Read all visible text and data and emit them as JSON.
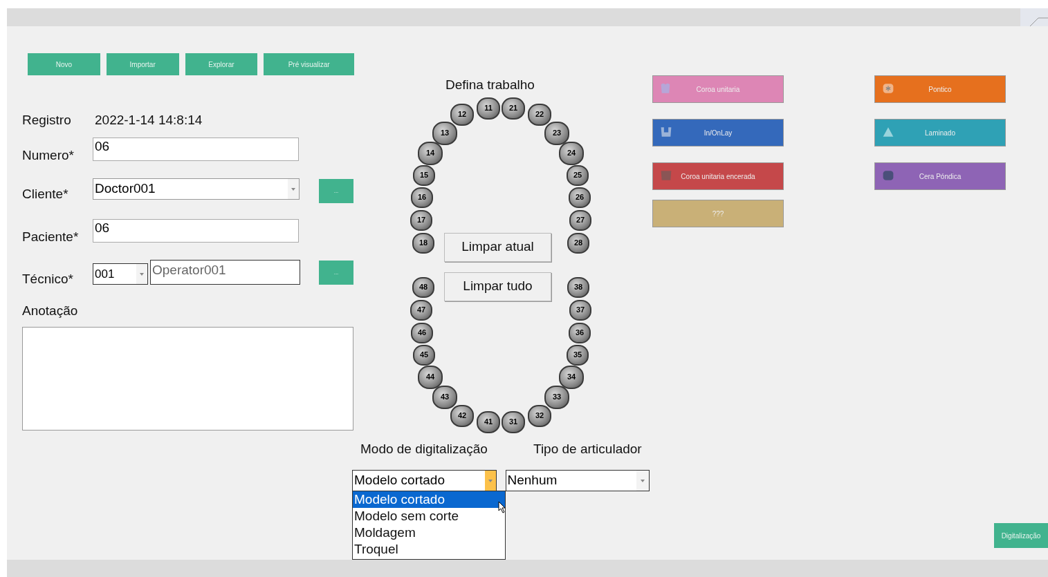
{
  "toolbar": [
    {
      "label": "Novo"
    },
    {
      "label": "Importar"
    },
    {
      "label": "Explorar"
    },
    {
      "label": "Pré visualizar"
    }
  ],
  "form": {
    "registro": {
      "label": "Registro",
      "value": "2022-1-14 14:8:14"
    },
    "numero": {
      "label": "Numero*",
      "value": "06"
    },
    "cliente": {
      "label": "Cliente*",
      "value": "Doctor001",
      "button": "..."
    },
    "paciente": {
      "label": "Paciente*",
      "value": "06"
    },
    "tecnico": {
      "label": "Técnico*",
      "code": "001",
      "name": "Operator001",
      "button": "..."
    },
    "anotacao": {
      "label": "Anotação"
    }
  },
  "chart": {
    "title": "Defina trabalho",
    "clear_current": "Limpar atual",
    "clear_all": "Limpar tudo",
    "teeth": [
      {
        "label": "11"
      },
      {
        "label": "12"
      },
      {
        "label": "13"
      },
      {
        "label": "14"
      },
      {
        "label": "15"
      },
      {
        "label": "16"
      },
      {
        "label": "17"
      },
      {
        "label": "18"
      },
      {
        "label": "21"
      },
      {
        "label": "22"
      },
      {
        "label": "23"
      },
      {
        "label": "24"
      },
      {
        "label": "25"
      },
      {
        "label": "26"
      },
      {
        "label": "27"
      },
      {
        "label": "28"
      },
      {
        "label": "38"
      },
      {
        "label": "37"
      },
      {
        "label": "36"
      },
      {
        "label": "35"
      },
      {
        "label": "34"
      },
      {
        "label": "33"
      },
      {
        "label": "32"
      },
      {
        "label": "31"
      },
      {
        "label": "48"
      },
      {
        "label": "47"
      },
      {
        "label": "46"
      },
      {
        "label": "45"
      },
      {
        "label": "44"
      },
      {
        "label": "43"
      },
      {
        "label": "42"
      },
      {
        "label": "41"
      }
    ]
  },
  "work_types": [
    {
      "label": "Coroa unitaria",
      "color": "#dd86b5",
      "kind": "crown"
    },
    {
      "label": "Pontico",
      "color": "#e6701e",
      "kind": "pontic"
    },
    {
      "label": "In/OnLay",
      "color": "#3469bb",
      "kind": "inlay"
    },
    {
      "label": "Laminado",
      "color": "#2fa1b5",
      "kind": "veneer"
    },
    {
      "label": "Coroa unitaria encerada",
      "color": "#c5484a",
      "kind": "wax"
    },
    {
      "label": "Cera Póndica",
      "color": "#8e64b5",
      "kind": "waxpontic"
    },
    {
      "label": "???",
      "color": "#c9b077",
      "kind": "plain"
    }
  ],
  "scan_mode": {
    "label": "Modo de digitalização",
    "value": "Modelo cortado",
    "options": [
      {
        "label": "Modelo cortado",
        "selected": true
      },
      {
        "label": "Modelo sem corte",
        "selected": false
      },
      {
        "label": "Moldagem",
        "selected": false
      },
      {
        "label": "Troquel",
        "selected": false
      }
    ]
  },
  "articulator": {
    "label": "Tipo de articulador",
    "value": "Nenhum"
  },
  "scan_button": "Digitalização"
}
